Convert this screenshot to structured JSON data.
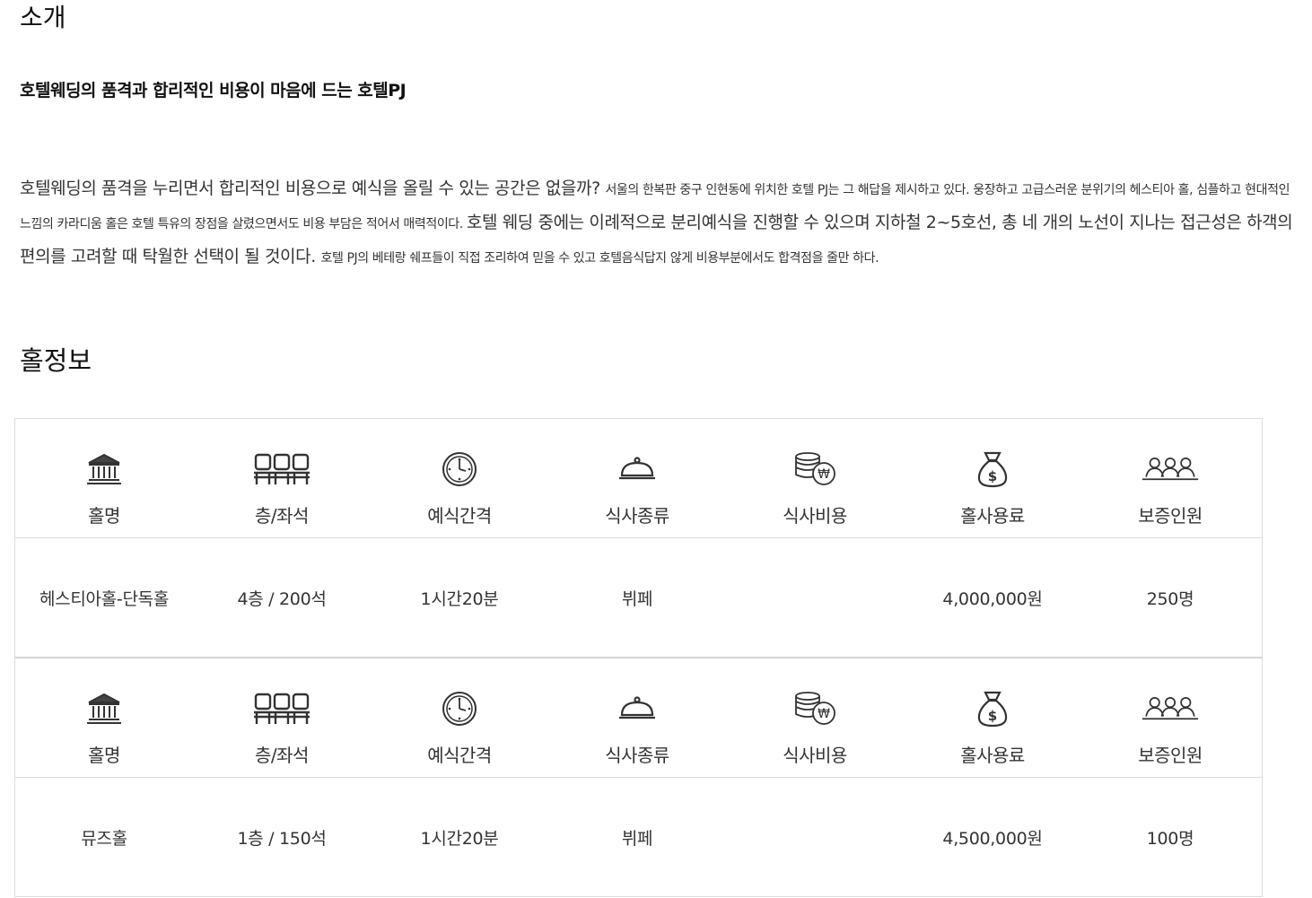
{
  "intro": {
    "title": "소개",
    "subtitle": "호텔웨딩의 품격과 합리적인 비용이 마음에 드는 호텔PJ",
    "segments": [
      {
        "text": "호텔웨딩의 품격을 누리면서 합리적인 비용으로 예식을 올릴 수 있는 공간은 없을까? ",
        "size": "lg"
      },
      {
        "text": "서울의 한복판 중구 인현동에 위치한 호텔 PJ는 그 해답을 제시하고 있다. 웅장하고 고급스러운 분위기의 헤스티아 홀, 심플하고 현대적인 느낌의 카라디움 홀은 호텔 특유의 장점을 살렸으면서도 비용 부담은 적어서 매력적이다. ",
        "size": "sm"
      },
      {
        "text": "호텔 웨딩 중에는 이례적으로 분리예식을 진행할 수 있으며 지하철 2~5호선, 총 네 개의 노선이 지나는 접근성은 하객의 편의를 고려할 때 탁월한 선택이 될 것이다. ",
        "size": "lg"
      },
      {
        "text": "호텔 PJ의 베테랑 쉐프들이 직접 조리하여 믿을 수 있고 호텔음식답지 않게 비용부분에서도 합격점을 줄만 하다.",
        "size": "sm"
      }
    ]
  },
  "hall_section": {
    "title": "홀정보",
    "headers": [
      {
        "label": "홀명",
        "icon": "hall-building-icon"
      },
      {
        "label": "층/좌석",
        "icon": "seats-icon"
      },
      {
        "label": "예식간격",
        "icon": "clock-icon"
      },
      {
        "label": "식사종류",
        "icon": "food-cloche-icon"
      },
      {
        "label": "식사비용",
        "icon": "coins-won-icon"
      },
      {
        "label": "홀사용료",
        "icon": "money-bag-icon"
      },
      {
        "label": "보증인원",
        "icon": "people-group-icon"
      }
    ],
    "halls": [
      {
        "name": "헤스티아홀-단독홀",
        "floor_seats": "4층 / 200석",
        "interval": "1시간20분",
        "meal_type": "뷔페",
        "meal_cost": "",
        "hall_fee": "4,000,000원",
        "guarantee": "250명"
      },
      {
        "name": "뮤즈홀",
        "floor_seats": "1층 / 150석",
        "interval": "1시간20분",
        "meal_type": "뷔페",
        "meal_cost": "",
        "hall_fee": "4,500,000원",
        "guarantee": "100명"
      }
    ]
  }
}
